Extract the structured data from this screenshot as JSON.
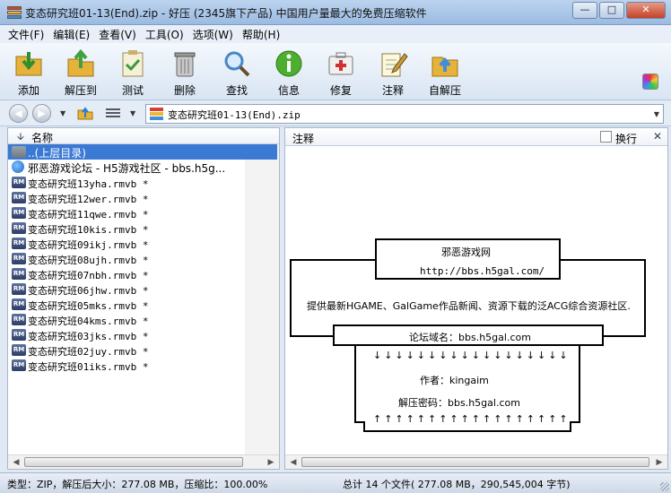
{
  "window": {
    "title": "变态研究班01-13(End).zip - 好压 (2345旗下产品) 中国用户量最大的免费压缩软件",
    "controls": [
      "minimize",
      "maximize",
      "close"
    ]
  },
  "menu": [
    "文件(F)",
    "编辑(E)",
    "查看(V)",
    "工具(O)",
    "选项(W)",
    "帮助(H)"
  ],
  "toolbar": [
    {
      "label": "添加",
      "icon": "add-icon",
      "color": "#2f8f2f"
    },
    {
      "label": "解压到",
      "icon": "extract-to-icon",
      "color": "#2a7fd4"
    },
    {
      "label": "测试",
      "icon": "test-icon",
      "color": "#3a9a3a"
    },
    {
      "label": "删除",
      "icon": "trash-icon",
      "color": "#777777"
    },
    {
      "label": "查找",
      "icon": "magnifier-icon",
      "color": "#4a86c8"
    },
    {
      "label": "信息",
      "icon": "info-icon",
      "color": "#4caf2f"
    },
    {
      "label": "修复",
      "icon": "repair-kit-icon",
      "color": "#d03030"
    },
    {
      "label": "注释",
      "icon": "notepad-pencil-icon",
      "color": "#c89a3a"
    },
    {
      "label": "自解压",
      "icon": "self-extract-icon",
      "color": "#e0a030"
    }
  ],
  "address": {
    "path": "变态研究班01-13(End).zip"
  },
  "filelist": {
    "column": "名称",
    "rows": [
      {
        "name": "..(上层目录)",
        "type": "folder",
        "selected": true
      },
      {
        "name": "邪恶游戏论坛 - H5游戏社区 - bbs.h5g...",
        "type": "ie",
        "selected": false
      },
      {
        "name": "变态研究班13yha.rmvb *",
        "type": "rm",
        "selected": false
      },
      {
        "name": "变态研究班12wer.rmvb *",
        "type": "rm",
        "selected": false
      },
      {
        "name": "变态研究班11qwe.rmvb *",
        "type": "rm",
        "selected": false
      },
      {
        "name": "变态研究班10kis.rmvb *",
        "type": "rm",
        "selected": false
      },
      {
        "name": "变态研究班09ikj.rmvb *",
        "type": "rm",
        "selected": false
      },
      {
        "name": "变态研究班08ujh.rmvb *",
        "type": "rm",
        "selected": false
      },
      {
        "name": "变态研究班07nbh.rmvb *",
        "type": "rm",
        "selected": false
      },
      {
        "name": "变态研究班06jhw.rmvb *",
        "type": "rm",
        "selected": false
      },
      {
        "name": "变态研究班05mks.rmvb *",
        "type": "rm",
        "selected": false
      },
      {
        "name": "变态研究班04kms.rmvb *",
        "type": "rm",
        "selected": false
      },
      {
        "name": "变态研究班03jks.rmvb *",
        "type": "rm",
        "selected": false
      },
      {
        "name": "变态研究班02juy.rmvb *",
        "type": "rm",
        "selected": false
      },
      {
        "name": "变态研究班01iks.rmvb *",
        "type": "rm",
        "selected": false
      }
    ]
  },
  "comment_panel": {
    "title": "注释",
    "wrap_label": "换行",
    "wrap_checked": false,
    "site_name": "邪恶游戏网",
    "site_url": "http://bbs.h5gal.com/",
    "description": "提供最新HGAME、GalGame作品新闻、资源下载的泛ACG综合资源社区.",
    "domain_line": "论坛域名：bbs.h5gal.com",
    "author_line": "作者：kingaim",
    "password_line": "解压密码：bbs.h5gal.com",
    "down_arrow": "↓",
    "up_arrow": "↑"
  },
  "status": {
    "left": "类型：ZIP，解压后大小：277.08 MB，压缩比：100.00%",
    "right": "总计 14 个文件( 277.08 MB，290,545,004 字节)"
  }
}
